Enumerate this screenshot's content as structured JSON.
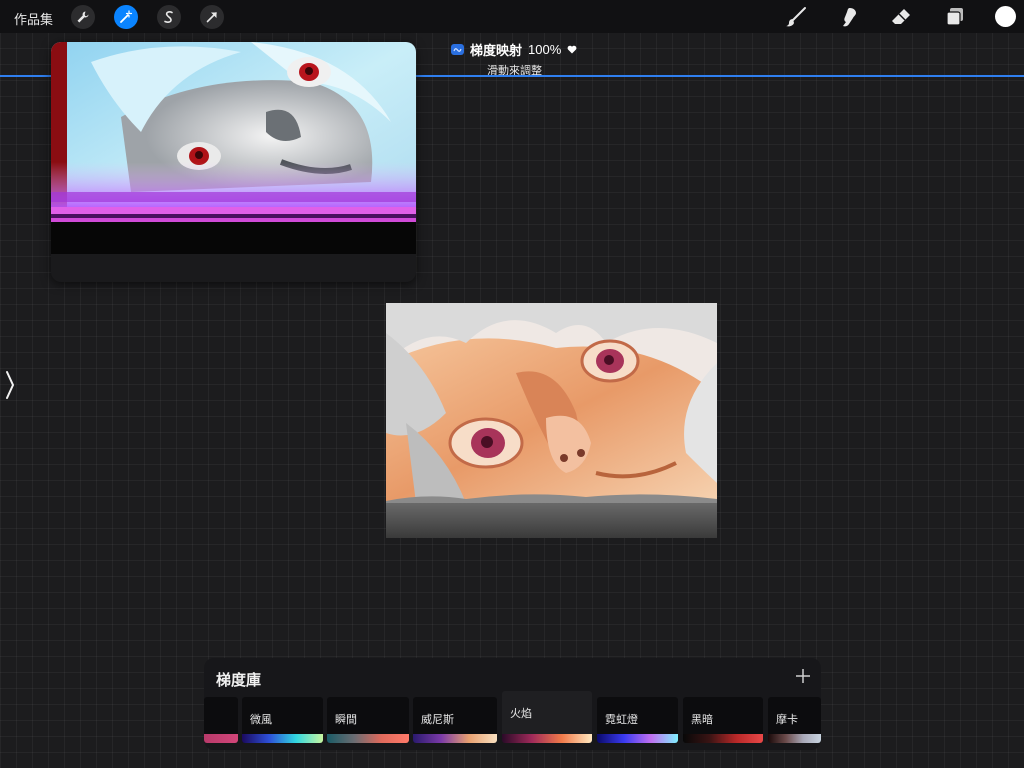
{
  "toolbar": {
    "gallery_label": "作品集",
    "left_tools": [
      "wrench-icon",
      "magic-wand-icon",
      "selection-icon",
      "transform-icon"
    ],
    "active_tool": "magic-wand-icon",
    "right_tools": [
      "brush-icon",
      "smudge-icon",
      "eraser-icon",
      "layers-icon"
    ],
    "current_color": "#ffffff"
  },
  "adjustment": {
    "name": "梯度映射",
    "value": "100%",
    "hint": "滑動來調整",
    "accent": "#2f7ff0"
  },
  "gradient_library": {
    "title": "梯度庫",
    "gradients": [
      {
        "name": "",
        "colors": [
          "#b83a6a",
          "#d2467a"
        ]
      },
      {
        "name": "微風",
        "colors": [
          "#1b0a5e",
          "#2d4fd8",
          "#31d6e0",
          "#c8f5a0"
        ]
      },
      {
        "name": "瞬間",
        "colors": [
          "#1a5b66",
          "#6a6c72",
          "#e06a5c",
          "#ff7a6a"
        ]
      },
      {
        "name": "威尼斯",
        "colors": [
          "#2a1a6e",
          "#7a3aa8",
          "#e8a070",
          "#f8e0c0"
        ]
      },
      {
        "name": "火焰",
        "colors": [
          "#2a0a28",
          "#a02a5a",
          "#f07a4a",
          "#ffe8c0"
        ]
      },
      {
        "name": "霓虹燈",
        "colors": [
          "#0a0a6a",
          "#3a3af0",
          "#c070f0",
          "#80f0ff"
        ]
      },
      {
        "name": "黑暗",
        "colors": [
          "#080808",
          "#3a1414",
          "#b82828",
          "#e84848"
        ]
      },
      {
        "name": "摩卡",
        "colors": [
          "#1a0a0a",
          "#6a4a4a",
          "#a8a8b8",
          "#c8d4e0"
        ]
      }
    ],
    "selected_index": 4
  },
  "colors": {
    "background": "#1c1c1e",
    "topbar": "#111113",
    "active_tool": "#0a84ff"
  }
}
